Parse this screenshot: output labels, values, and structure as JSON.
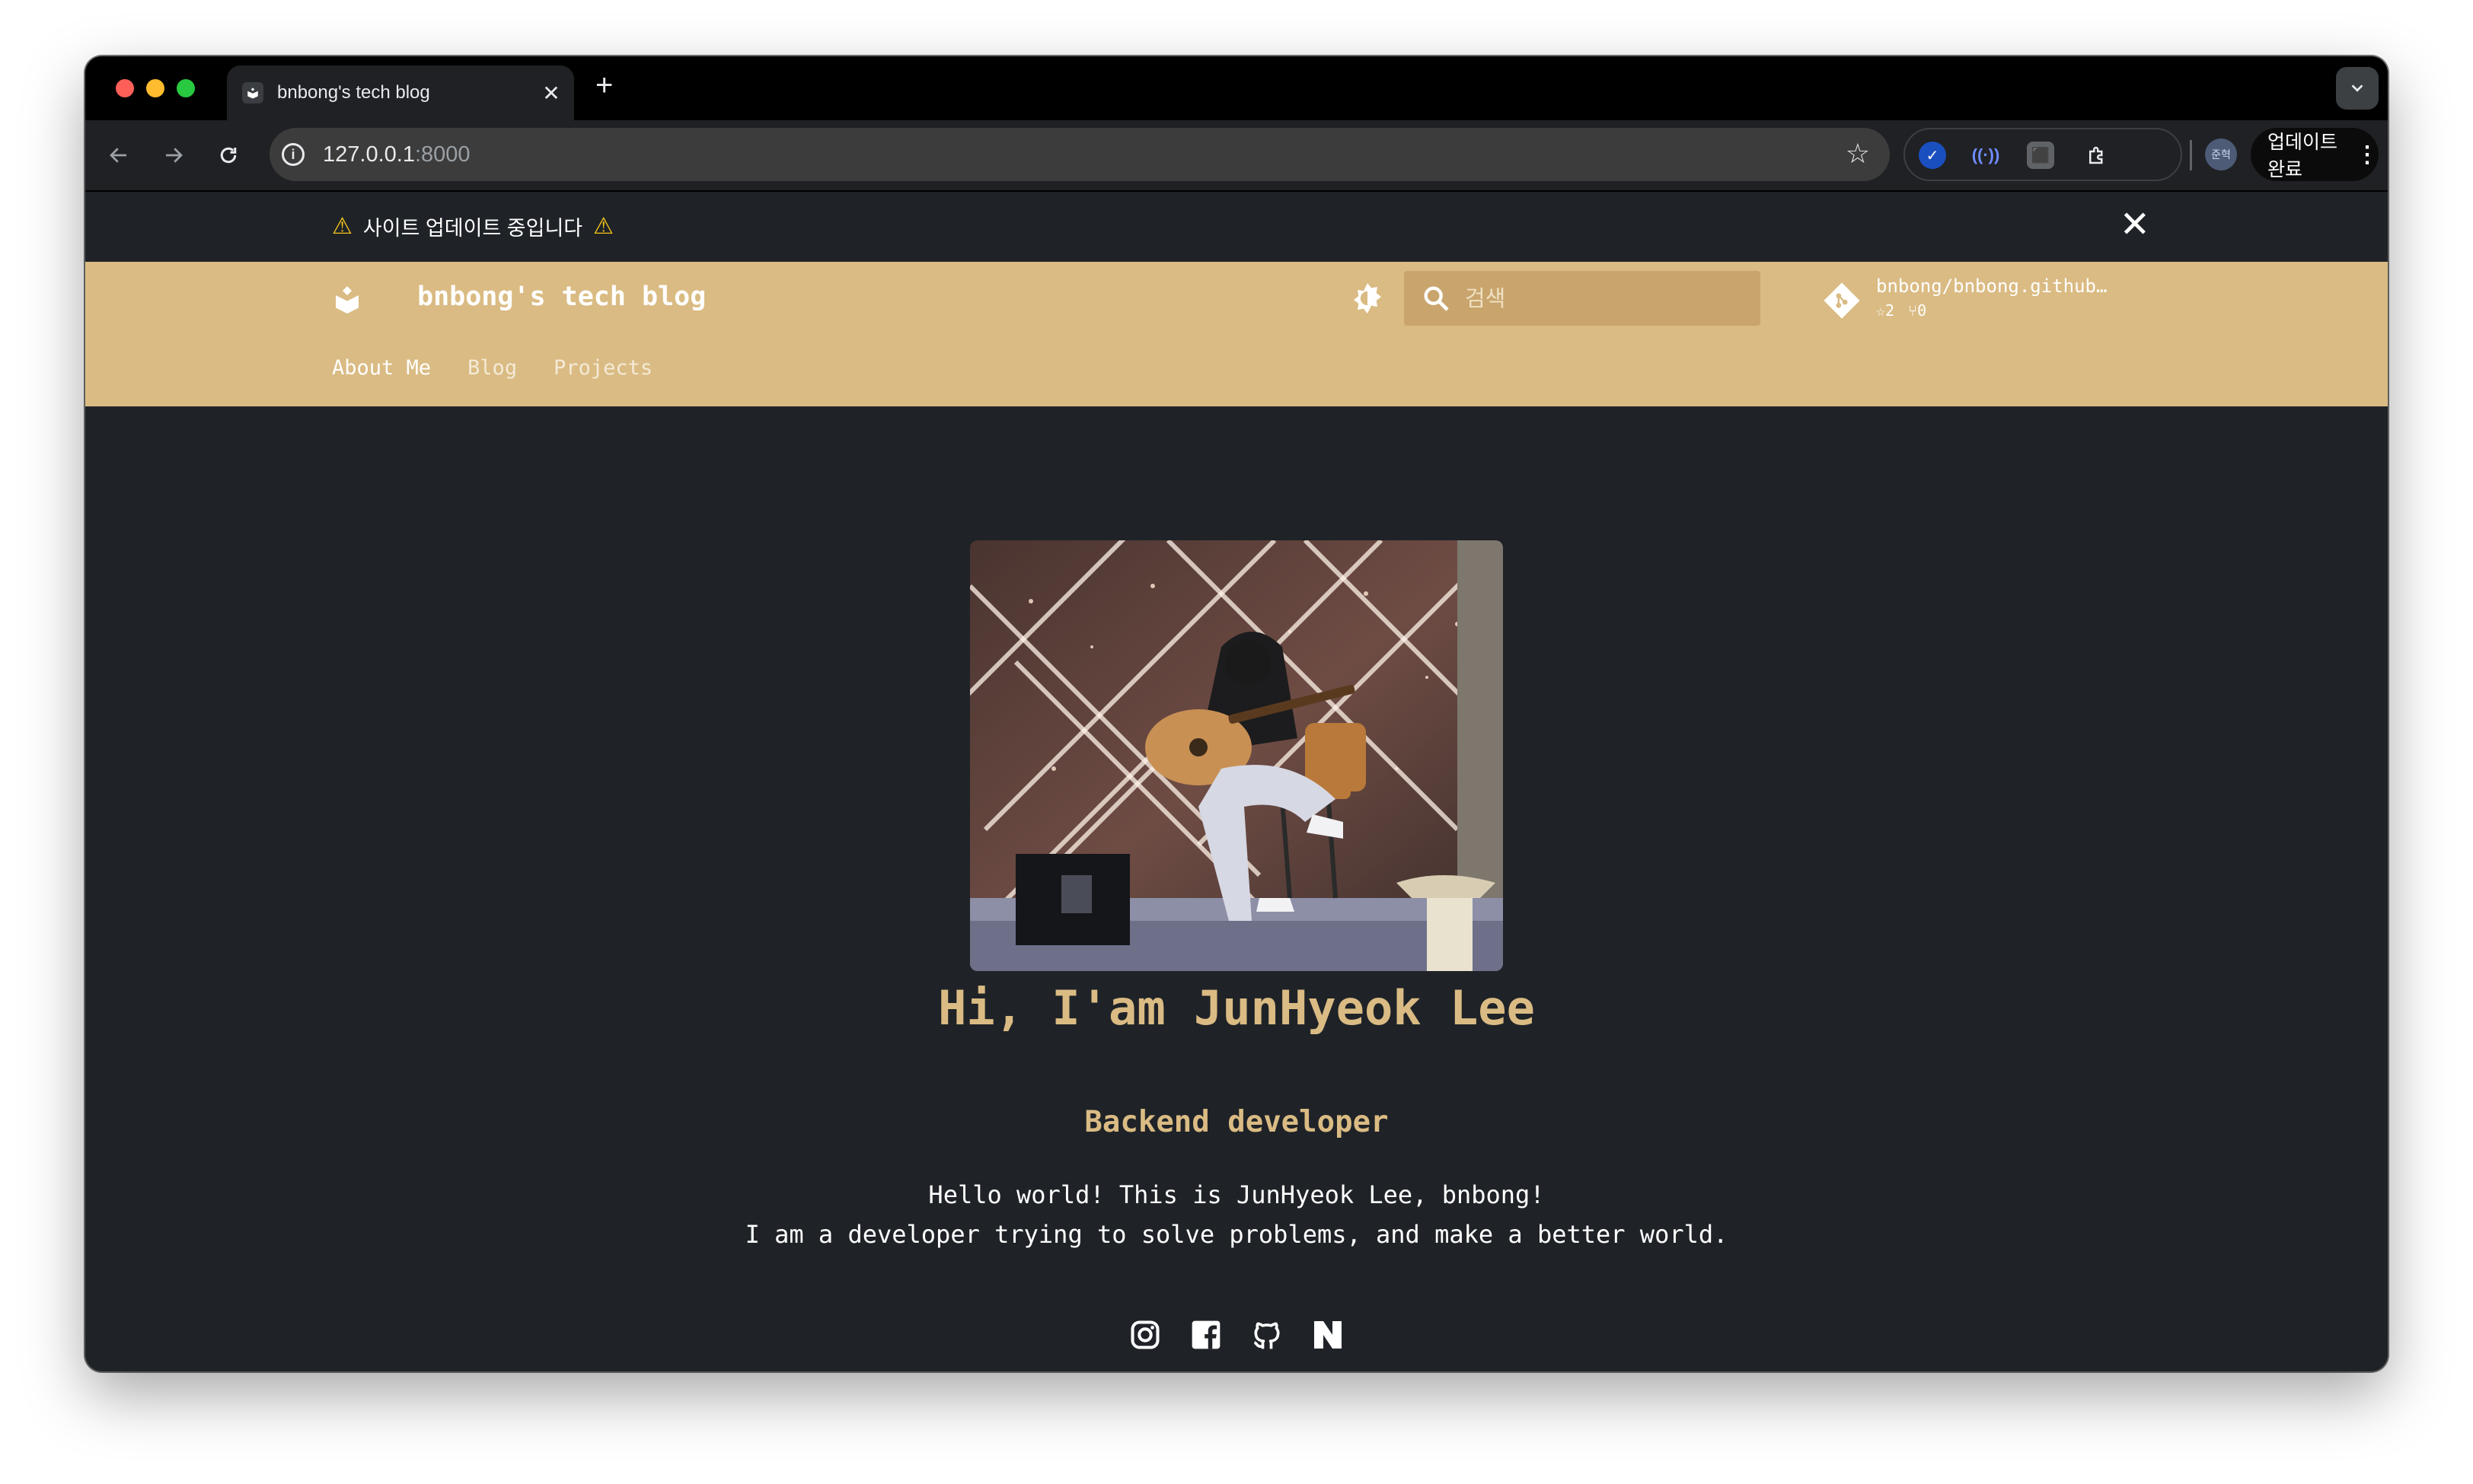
{
  "browser": {
    "tab_title": "bnbong's tech blog",
    "tab_close": "✕",
    "new_tab": "+",
    "url_host": "127.0.0.1",
    "url_port": ":8000",
    "profile_label": "준혁",
    "update_label": "업데이트 완료"
  },
  "announcement": {
    "text": "사이트 업데이트 중입니다",
    "close": "✕"
  },
  "header": {
    "site_title": "bnbong's tech blog",
    "search_placeholder": "검색",
    "repo_name": "bnbong/bnbong.github…",
    "repo_stars": "2",
    "repo_forks": "0",
    "tabs": [
      "About Me",
      "Blog",
      "Projects"
    ]
  },
  "hero": {
    "title": "Hi, I'am JunHyeok Lee",
    "subtitle": "Backend developer",
    "bio_line1": "Hello world! This is JunHyeok Lee, bnbong!",
    "bio_line2": "I am a developer trying to solve problems, and make a better world."
  },
  "socials": [
    "instagram-icon",
    "facebook-icon",
    "github-icon",
    "naver-icon"
  ],
  "colors": {
    "accent": "#dabb83",
    "page_bg": "#1f2328",
    "search_bg": "#c9a56d"
  }
}
